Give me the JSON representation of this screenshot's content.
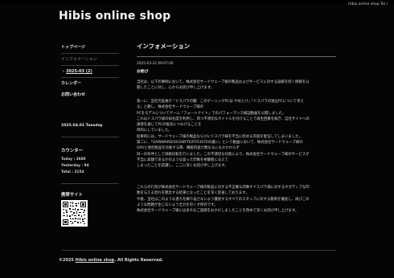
{
  "header": {
    "site_title": "Hibis online shop",
    "tagline": "Hibis online shop  Tel /"
  },
  "sidebar": {
    "items": [
      {
        "label": "トップページ"
      },
      {
        "label": "インフォメーション"
      },
      {
        "arrow": "›",
        "label": "2025-03 (2)"
      },
      {
        "label": "カレンダー"
      },
      {
        "label": "お問い合わせ"
      }
    ],
    "date": "2025.04.01 Tuesday",
    "counter": {
      "title": "カウンター",
      "today_label": "Today",
      "today_value": "2680",
      "yesterday_label": "Yesterday",
      "yesterday_value": "94",
      "total_label": "Total",
      "total_value": "3154"
    },
    "mobile_title": "携帯サイト"
  },
  "main": {
    "heading": "インフォメーション",
    "post_time": "2025-03-22 09:07:00",
    "post_title": "お詫び",
    "para1": [
      "当社は、以下の事例において、株式会社サードウェーブ様の製品およびサービスに対する誤解を招く情報を公",
      "開したことに対し、心からお詫び申し上げます。"
    ],
    "para2": [
      "第一に、当社元役員が「ドスパラの闇　このゲーミングPCは やめとけ」「ドスパラの独立PCについて考え",
      "る」と題し、株式会社サードウェーブ様の",
      "PCをモデルについてゲーム「フォートナイト」でのパフォーマンス検証動画を公開しました。",
      "これはドスパラ様の知名度を利用し、目つ不適切なタイトルを付けることで再生回数を稼ぎ、自社サイトへの",
      "誘導を通じてPCの販売につなげることを",
      "目的にしていました。",
      "結果的には、サードウェーブ様の製品ならびにドスパラ様を不当に貶める内容を配信してしまいました。",
      "第二に、「GAINWARD/GIGABYTE/RTX3070の違い」という動画において、株式会社サードウェーブ様の",
      "GPUと他社製品を比較する際、機能内容が異なるにもかかわらず",
      "同一の条件として価格比較を行いました。この不適切な比較により、株式会社サードウェーブ様のサービスが",
      "不当に高額であるかのような誤った印象を視聴者に与えて",
      "しまったことを認識し、ここに深くお詫び申し上げます。"
    ],
    "para3": [
      "これらの行為が株式会社サードウェーブ様の製品に対する不正確な印象やドスパラ様に対するネガティブな印",
      "象を与える恐れを懸念する結果となったことを深く反省しております。",
      "今後、当社はこのような過ちを繰り返さないよう徹底するすべてのスタッフに対する教育を徹底し、再びこの",
      "ような問題が生じないよう全力を尽くす所存です。",
      "株式会社サードウェーブ様には多大なご迷惑をおかけしましたことを改めて深くお詫び申し上げます。"
    ]
  },
  "footer": {
    "prefix": "©2025",
    "link": "Hibis online shop",
    "suffix": ". All Rights Reserved."
  }
}
